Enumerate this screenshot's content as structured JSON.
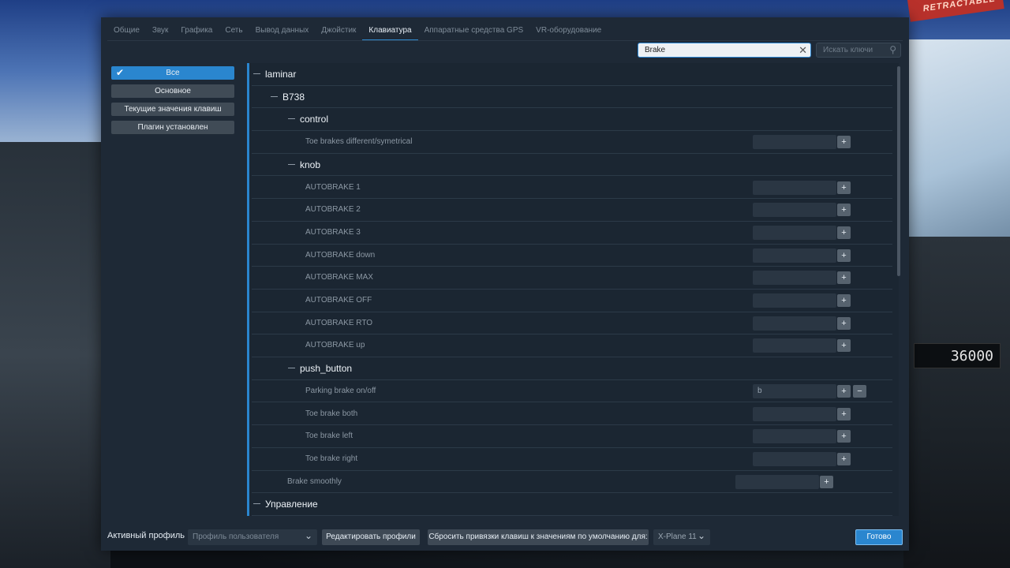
{
  "background": {
    "banner_text": "RETRACTABLE",
    "instrument_readout": "36000"
  },
  "tabs": [
    {
      "label": "Общие",
      "active": false
    },
    {
      "label": "Звук",
      "active": false
    },
    {
      "label": "Графика",
      "active": false
    },
    {
      "label": "Сеть",
      "active": false
    },
    {
      "label": "Вывод данных",
      "active": false
    },
    {
      "label": "Джойстик",
      "active": false
    },
    {
      "label": "Клавиатура",
      "active": true
    },
    {
      "label": "Аппаратные средства GPS",
      "active": false
    },
    {
      "label": "VR-оборудование",
      "active": false
    }
  ],
  "search": {
    "value": "Brake",
    "clear_icon": "close-icon",
    "keys_placeholder": "Искать ключи",
    "keys_icon": "search-icon"
  },
  "sidebar": {
    "items": [
      {
        "label": "Все",
        "active": true
      },
      {
        "label": "Основное",
        "active": false
      },
      {
        "label": "Текущие значения клавиш",
        "active": false
      },
      {
        "label": "Плагин установлен",
        "active": false
      }
    ]
  },
  "tree": {
    "rows": [
      {
        "type": "group",
        "label": "laminar",
        "level": 0
      },
      {
        "type": "group",
        "label": "B738",
        "level": 1
      },
      {
        "type": "group",
        "label": "control",
        "level": 2
      },
      {
        "type": "item",
        "label": "Toe brakes different/symetrical",
        "level": 3,
        "key": "",
        "has_minus": false
      },
      {
        "type": "group",
        "label": "knob",
        "level": 2
      },
      {
        "type": "item",
        "label": "AUTOBRAKE 1",
        "level": 3,
        "key": "",
        "has_minus": false
      },
      {
        "type": "item",
        "label": "AUTOBRAKE 2",
        "level": 3,
        "key": "",
        "has_minus": false
      },
      {
        "type": "item",
        "label": "AUTOBRAKE 3",
        "level": 3,
        "key": "",
        "has_minus": false
      },
      {
        "type": "item",
        "label": "AUTOBRAKE down",
        "level": 3,
        "key": "",
        "has_minus": false
      },
      {
        "type": "item",
        "label": "AUTOBRAKE MAX",
        "level": 3,
        "key": "",
        "has_minus": false
      },
      {
        "type": "item",
        "label": "AUTOBRAKE OFF",
        "level": 3,
        "key": "",
        "has_minus": false
      },
      {
        "type": "item",
        "label": "AUTOBRAKE RTO",
        "level": 3,
        "key": "",
        "has_minus": false
      },
      {
        "type": "item",
        "label": "AUTOBRAKE up",
        "level": 3,
        "key": "",
        "has_minus": false
      },
      {
        "type": "group",
        "label": "push_button",
        "level": 2
      },
      {
        "type": "item",
        "label": "Parking brake on/off",
        "level": 3,
        "key": "b",
        "has_minus": true
      },
      {
        "type": "item",
        "label": "Toe brake both",
        "level": 3,
        "key": "",
        "has_minus": false
      },
      {
        "type": "item",
        "label": "Toe brake left",
        "level": 3,
        "key": "",
        "has_minus": false
      },
      {
        "type": "item",
        "label": "Toe brake right",
        "level": 3,
        "key": "",
        "has_minus": false
      },
      {
        "type": "item",
        "label": "Brake smoothly",
        "level": 2,
        "key": "",
        "has_minus": false
      },
      {
        "type": "group",
        "label": "Управление",
        "level": 0
      }
    ],
    "plus_label": "+",
    "minus_label": "−"
  },
  "footer": {
    "active_profile_label": "Активный профиль",
    "profile_value": "Профиль пользователя",
    "edit_profiles_label": "Редактировать профили",
    "reset_label": "Сбросить привязки клавиш к значениям по умолчанию для:",
    "xplane_value": "X-Plane 11",
    "done_label": "Готово"
  },
  "colors": {
    "accent": "#2a86cf",
    "dialog_bg": "#1e2936"
  }
}
